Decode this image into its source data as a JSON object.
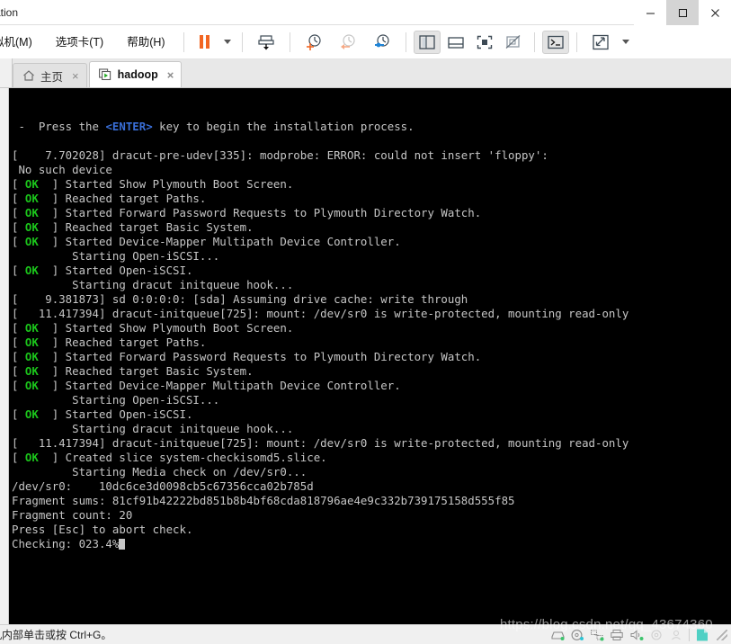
{
  "window": {
    "title": "ation",
    "controls": {
      "minimize": "minimize-icon",
      "restore": "restore-icon",
      "close": "close-icon"
    }
  },
  "menu": {
    "items": [
      {
        "label": "拟机(M)",
        "name": "menu-virtual-machine"
      },
      {
        "label": "选项卡(T)",
        "name": "menu-tabs"
      },
      {
        "label": "帮助(H)",
        "name": "menu-help"
      }
    ]
  },
  "toolbar": {
    "buttons": [
      {
        "name": "pause-button",
        "icon": "pause-icon",
        "label": ""
      },
      {
        "name": "pause-dropdown",
        "icon": "chevron-down-icon",
        "label": ""
      },
      {
        "name": "send-ctrl-alt-del-button",
        "icon": "send-key-icon",
        "label": ""
      },
      {
        "name": "take-snapshot-button",
        "icon": "snapshot-add-icon",
        "label": ""
      },
      {
        "name": "revert-snapshot-button",
        "icon": "snapshot-revert-icon",
        "label": ""
      },
      {
        "name": "snapshot-manager-button",
        "icon": "snapshot-manage-icon",
        "label": ""
      },
      {
        "name": "show-library-button",
        "icon": "sidebar-panel-icon",
        "label": ""
      },
      {
        "name": "show-thumbnail-bar-button",
        "icon": "bottom-panel-icon",
        "label": ""
      },
      {
        "name": "fullscreen-button",
        "icon": "fullscreen-icon",
        "label": ""
      },
      {
        "name": "unity-mode-button",
        "icon": "unity-mode-disabled-icon",
        "label": ""
      },
      {
        "name": "console-view-button",
        "icon": "terminal-prompt-icon",
        "label": ""
      },
      {
        "name": "stretch-guest-button",
        "icon": "expand-diagonal-icon",
        "label": ""
      },
      {
        "name": "stretch-dropdown",
        "icon": "chevron-down-icon",
        "label": ""
      }
    ]
  },
  "tabs": [
    {
      "label": "主页",
      "icon": "home-icon",
      "selected": false,
      "close": "×"
    },
    {
      "label": "hadoop",
      "icon": "vm-play-icon",
      "selected": true,
      "close": "×"
    }
  ],
  "console": {
    "lines": [
      {
        "type": "plain",
        "text": " -  Press the ",
        "enter": "<ENTER>",
        "tail": " key to begin the installation process."
      },
      {
        "type": "blank",
        "text": ""
      },
      {
        "type": "plain",
        "text": "[    7.702028] dracut-pre-udev[335]: modprobe: ERROR: could not insert 'floppy':"
      },
      {
        "type": "plain",
        "text": " No such device"
      },
      {
        "type": "ok",
        "text": "Started Show Plymouth Boot Screen."
      },
      {
        "type": "ok",
        "text": "Reached target Paths."
      },
      {
        "type": "ok",
        "text": "Started Forward Password Requests to Plymouth Directory Watch."
      },
      {
        "type": "ok",
        "text": "Reached target Basic System."
      },
      {
        "type": "ok",
        "text": "Started Device-Mapper Multipath Device Controller."
      },
      {
        "type": "plain",
        "text": "         Starting Open-iSCSI..."
      },
      {
        "type": "ok",
        "text": "Started Open-iSCSI."
      },
      {
        "type": "plain",
        "text": "         Starting dracut initqueue hook..."
      },
      {
        "type": "plain",
        "text": "[    9.381873] sd 0:0:0:0: [sda] Assuming drive cache: write through"
      },
      {
        "type": "plain",
        "text": "[   11.417394] dracut-initqueue[725]: mount: /dev/sr0 is write-protected, mounting read-only"
      },
      {
        "type": "ok",
        "text": "Started Show Plymouth Boot Screen."
      },
      {
        "type": "ok",
        "text": "Reached target Paths."
      },
      {
        "type": "ok",
        "text": "Started Forward Password Requests to Plymouth Directory Watch."
      },
      {
        "type": "ok",
        "text": "Reached target Basic System."
      },
      {
        "type": "ok",
        "text": "Started Device-Mapper Multipath Device Controller."
      },
      {
        "type": "plain",
        "text": "         Starting Open-iSCSI..."
      },
      {
        "type": "ok",
        "text": "Started Open-iSCSI."
      },
      {
        "type": "plain",
        "text": "         Starting dracut initqueue hook..."
      },
      {
        "type": "plain",
        "text": "[   11.417394] dracut-initqueue[725]: mount: /dev/sr0 is write-protected, mounting read-only"
      },
      {
        "type": "ok",
        "text": "Created slice system-checkisomd5.slice."
      },
      {
        "type": "plain",
        "text": "         Starting Media check on /dev/sr0..."
      },
      {
        "type": "plain",
        "text": "/dev/sr0:    10dc6ce3d0098cb5c67356cca02b785d"
      },
      {
        "type": "plain",
        "text": "Fragment sums: 81cf91b42222bd851b8b4bf68cda818796ae4e9c332b739175158d555f85"
      },
      {
        "type": "plain",
        "text": "Fragment count: 20"
      },
      {
        "type": "plain",
        "text": "Press [Esc] to abort check."
      },
      {
        "type": "cursor",
        "text": "Checking: 023.4%"
      }
    ],
    "ok_label": "OK",
    "bracket_open": "[",
    "bracket_close": "]"
  },
  "statusbar": {
    "hint": "机内部单击或按 Ctrl+G。",
    "icons": [
      {
        "name": "hard-disk-status-icon"
      },
      {
        "name": "cd-dvd-status-icon"
      },
      {
        "name": "network-adapter-status-icon"
      },
      {
        "name": "printer-status-icon"
      },
      {
        "name": "sound-card-status-icon"
      },
      {
        "name": "usb-status-icon"
      },
      {
        "name": "shared-folders-status-icon"
      },
      {
        "name": "message-log-status-icon"
      }
    ]
  },
  "watermark": {
    "text": "https://blog.csdn.net/qq_43674360"
  },
  "colors": {
    "accent_orange": "#f26522",
    "accent_blue": "#1f84d6",
    "terminal_bg": "#000000",
    "terminal_fg": "#c6c6c6",
    "terminal_ok": "#1bc41b",
    "terminal_enter": "#3a6fd8"
  }
}
